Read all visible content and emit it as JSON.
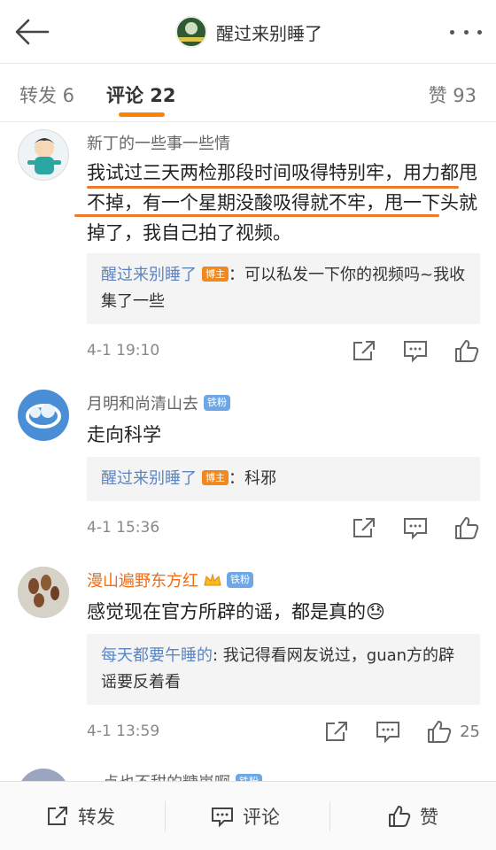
{
  "header": {
    "title": "醒过来别睡了",
    "back_icon": "back-arrow-icon",
    "more_icon": "more-dots-icon"
  },
  "tabs": {
    "repost": "转发 6",
    "comments": "评论 22",
    "likes": "赞 93"
  },
  "comments": [
    {
      "user": "新丁的一些事一些情",
      "text": "我试过三天两检那段时间吸得特别牢，用力都甩不掉，有一个星期没酸吸得就不牢，甩一下头就掉了，我自己拍了视频。",
      "reply_name": "醒过来别睡了",
      "reply_badge": "博主",
      "reply_text": "：可以私发一下你的视频吗~我收集了一些",
      "time": "4-1 19:10",
      "like_count": ""
    },
    {
      "user": "月明和尚清山去",
      "user_badge": "铁粉",
      "text": "走向科学",
      "reply_name": "醒过来别睡了",
      "reply_badge": "博主",
      "reply_text": "：科邪",
      "time": "4-1 15:36",
      "like_count": ""
    },
    {
      "user": "漫山遍野东方红",
      "user_badge": "铁粉",
      "text": "感觉现在官方所辟的谣，都是真的😓",
      "reply_name": "每天都要午睡的",
      "reply_text": ": 我记得看网友说过，guan方的辟谣要反着看",
      "time": "4-1 13:59",
      "like_count": "25"
    },
    {
      "user": "一点也不甜的糖崽啊",
      "user_badge": "铁粉"
    }
  ],
  "bottom": {
    "repost": "转发",
    "comment": "评论",
    "like": "赞"
  },
  "colors": {
    "accent": "#ff8200",
    "link": "#5b85c2",
    "host_badge": "#f08a1d",
    "fan_badge": "#6ea7e6"
  }
}
